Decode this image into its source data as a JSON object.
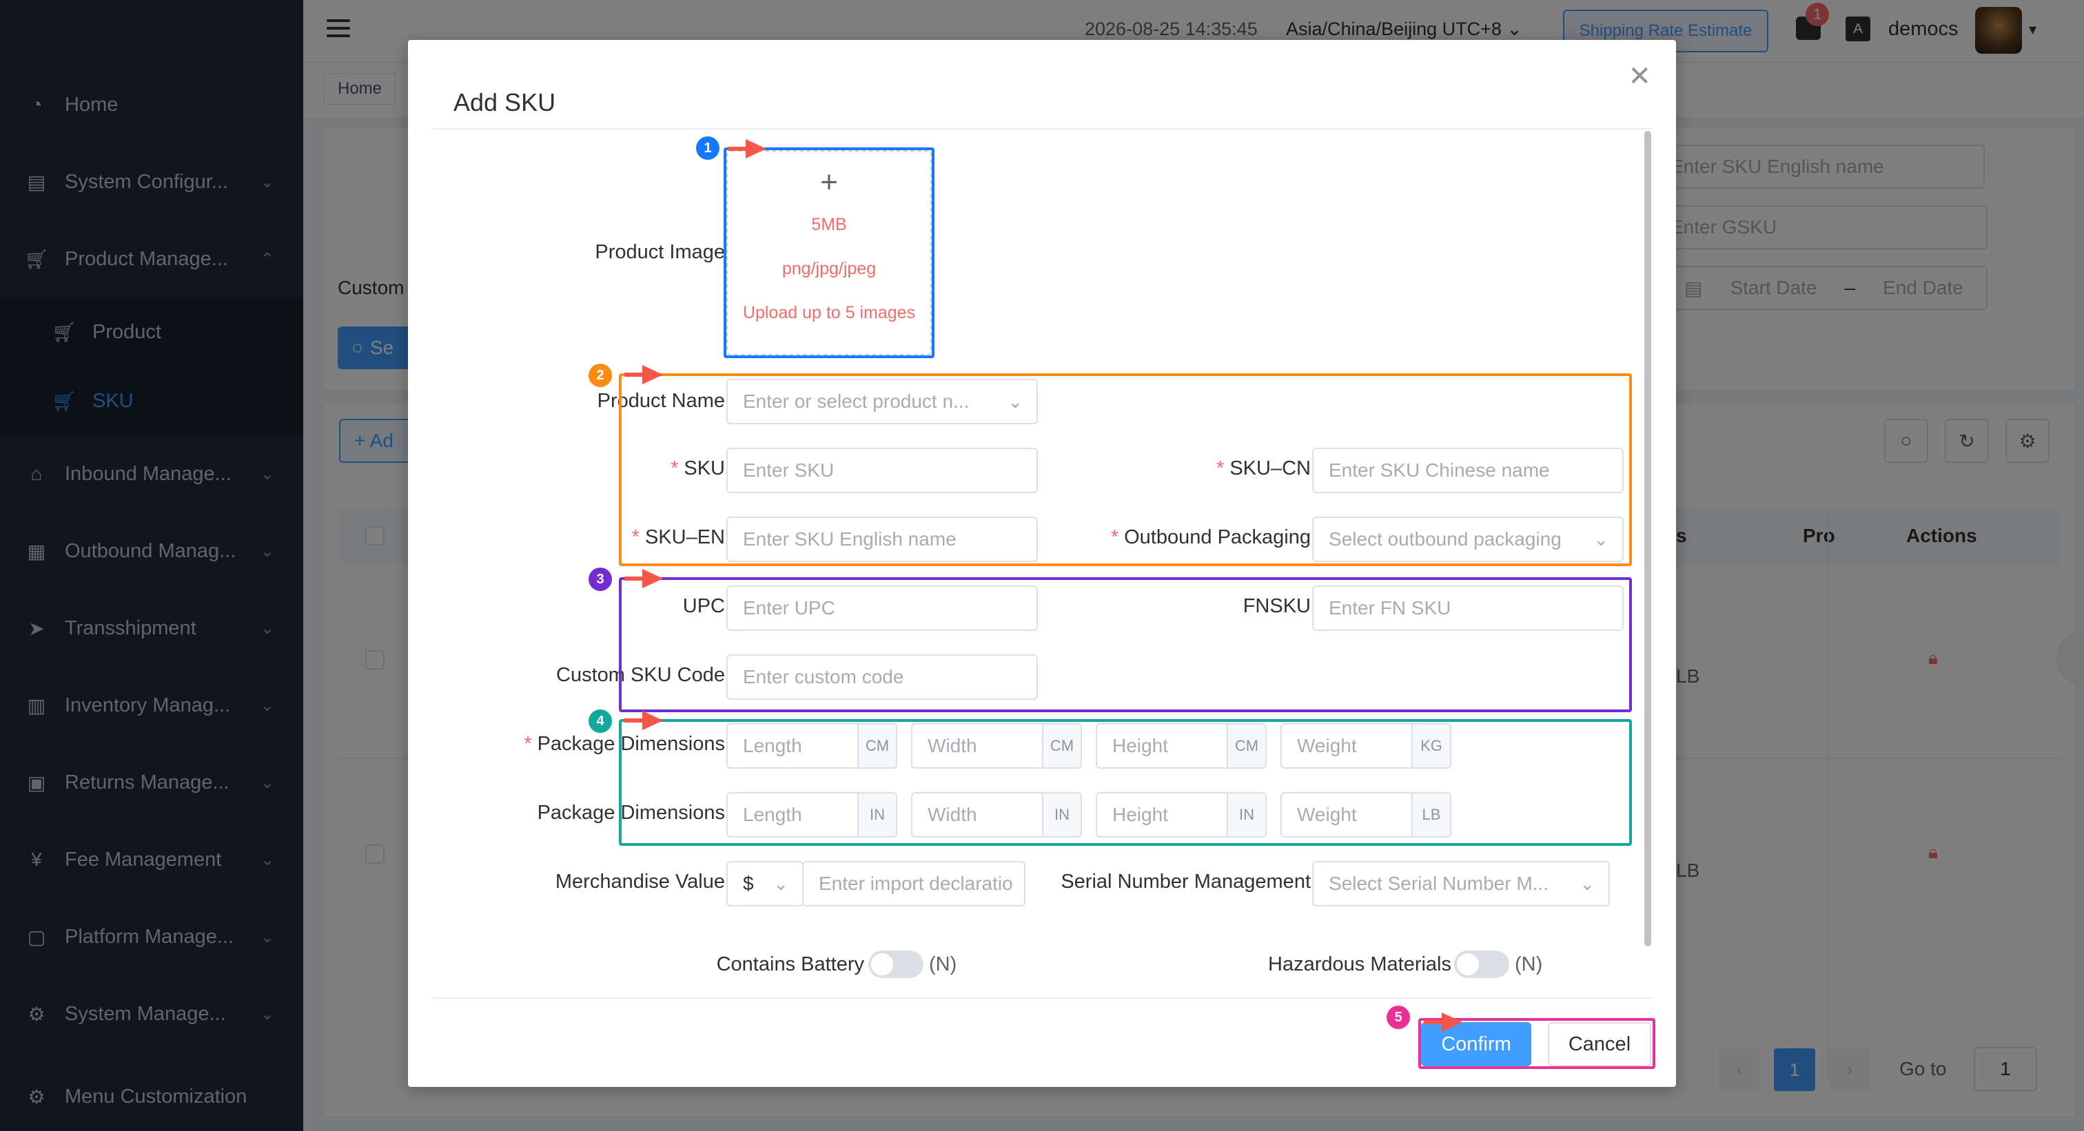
{
  "sidebar": {
    "items": [
      {
        "label": "Home",
        "icon": "dashboard-icon"
      },
      {
        "label": "System Configur...",
        "icon": "config-icon"
      },
      {
        "label": "Product Manage...",
        "icon": "cart-icon"
      },
      {
        "label": "Product",
        "icon": "cart-icon"
      },
      {
        "label": "SKU",
        "icon": "cart-icon"
      },
      {
        "label": "Inbound Manage...",
        "icon": "inbound-icon"
      },
      {
        "label": "Outbound Manag...",
        "icon": "grid-icon"
      },
      {
        "label": "Transshipment",
        "icon": "send-icon"
      },
      {
        "label": "Inventory Manag...",
        "icon": "table-icon"
      },
      {
        "label": "Returns Manage...",
        "icon": "returns-icon"
      },
      {
        "label": "Fee Management",
        "icon": "yen-icon"
      },
      {
        "label": "Platform Manage...",
        "icon": "platform-icon"
      },
      {
        "label": "System Manage...",
        "icon": "gear-icon"
      },
      {
        "label": "Menu Customization",
        "icon": "gear-icon"
      }
    ]
  },
  "header": {
    "datetime": "2026-08-25 14:35:45",
    "timezone": "Asia/China/Beijing UTC+8",
    "shipping_btn": "Shipping Rate Estimate",
    "message_count": "1",
    "lang_icon": "A",
    "username": "democs"
  },
  "background": {
    "tag_home": "Home",
    "filter_placeholders": {
      "sku_en": "Enter SKU English name",
      "gsku": "Enter GSKU",
      "start_date": "Start Date",
      "date_sep": "–",
      "end_date": "End Date"
    },
    "customer_label": "Custom",
    "search_btn": "Se",
    "add_btn": "+ Ad",
    "table_headers": {
      "col_s": "s",
      "col_pro": "Pro",
      "actions": "Actions"
    },
    "rows": [
      {
        "unit": "LB"
      },
      {
        "unit": "LB"
      }
    ],
    "pager": {
      "current": "1",
      "goto_label": "Go to",
      "goto_value": "1"
    }
  },
  "dialog": {
    "title": "Add SKU",
    "upload": {
      "size": "5MB",
      "formats": "png/jpg/jpeg",
      "limit": "Upload up to 5 images"
    },
    "labels": {
      "product_image": "Product Image",
      "product_name": "Product Name",
      "sku": "SKU",
      "sku_cn": "SKU–CN",
      "sku_en": "SKU–EN",
      "outbound_packaging": "Outbound Packaging",
      "upc": "UPC",
      "fnsku": "FNSKU",
      "custom_sku_code": "Custom SKU Code",
      "package_dimensions_metric": "Package Dimensions",
      "package_dimensions_imperial": "Package Dimensions",
      "merchandise_value": "Merchandise Value",
      "serial_number_management": "Serial Number Management",
      "contains_battery": "Contains Battery",
      "hazardous_materials": "Hazardous Materials"
    },
    "placeholders": {
      "product_name": "Enter or select product n...",
      "sku": "Enter SKU",
      "sku_cn": "Enter SKU Chinese name",
      "sku_en": "Enter SKU English name",
      "outbound_packaging": "Select outbound packaging",
      "upc": "Enter UPC",
      "fnsku": "Enter FN SKU",
      "custom_code": "Enter custom code",
      "length": "Length",
      "width": "Width",
      "height": "Height",
      "weight": "Weight",
      "import_declaration": "Enter import declaratio",
      "serial_number": "Select Serial Number M..."
    },
    "units": {
      "cm": "CM",
      "kg": "KG",
      "in": "IN",
      "lb": "LB"
    },
    "currency": "$",
    "battery_state": "(N)",
    "hazardous_state": "(N)",
    "confirm_btn": "Confirm",
    "cancel_btn": "Cancel"
  },
  "annotations": {
    "steps": [
      "1",
      "2",
      "3",
      "4",
      "5"
    ],
    "colors": {
      "step1": "#1677ff",
      "step2": "#fa8c16",
      "step3": "#722ed1",
      "step4": "#13a89e",
      "step5": "#eb2f96",
      "arrow": "#f5564a"
    }
  }
}
